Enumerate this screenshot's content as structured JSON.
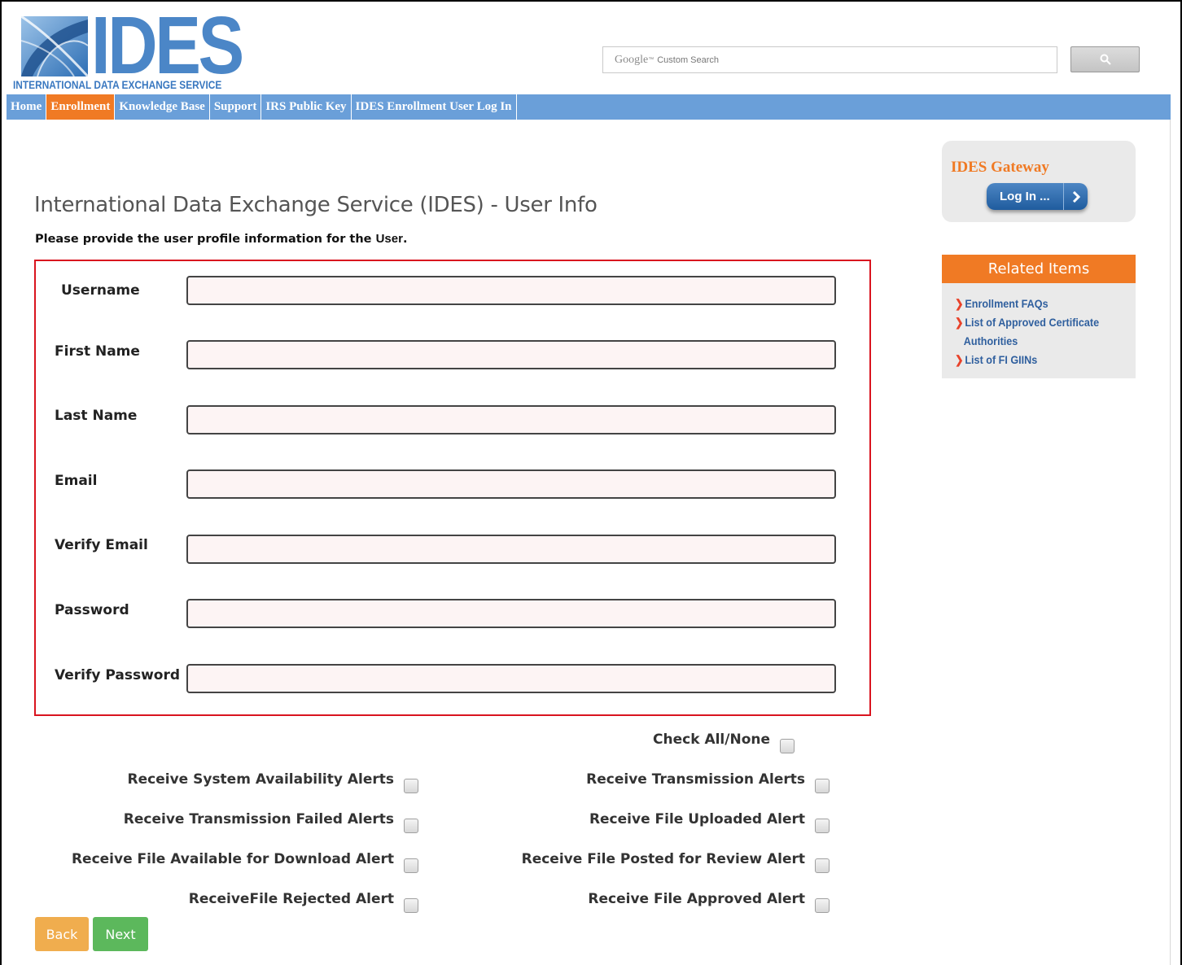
{
  "header": {
    "logo_text": "IDES",
    "logo_subtitle": "INTERNATIONAL DATA EXCHANGE SERVICE",
    "search": {
      "google_label": "Google",
      "tm": "™",
      "custom_search_label": "Custom Search",
      "button_icon": "search-icon"
    }
  },
  "nav": {
    "items": [
      {
        "label": "Home",
        "active": false
      },
      {
        "label": "Enrollment",
        "active": true
      },
      {
        "label": "Knowledge Base",
        "active": false
      },
      {
        "label": "Support",
        "active": false
      },
      {
        "label": "IRS Public Key",
        "active": false
      },
      {
        "label": "IDES Enrollment User Log In",
        "active": false
      }
    ]
  },
  "main": {
    "title": "International Data Exchange Service (IDES) - User Info",
    "instruction_prefix": "Please provide the user profile information for the ",
    "instruction_emphasis": "User",
    "instruction_suffix": ".",
    "fields": [
      {
        "label": "Username",
        "value": ""
      },
      {
        "label": "First Name",
        "value": ""
      },
      {
        "label": "Last Name",
        "value": ""
      },
      {
        "label": "Email",
        "value": ""
      },
      {
        "label": "Verify Email",
        "value": ""
      },
      {
        "label": "Password",
        "value": ""
      },
      {
        "label": "Verify Password",
        "value": ""
      }
    ],
    "check_all_label": "Check All/None",
    "alerts_left": [
      "Receive System Availability Alerts",
      "Receive Transmission Failed Alerts",
      "Receive File Available for Download Alert",
      "ReceiveFile Rejected Alert"
    ],
    "alerts_right": [
      "Receive Transmission Alerts",
      "Receive File Uploaded Alert",
      "Receive File Posted for Review Alert",
      "Receive File Approved Alert"
    ],
    "back_label": "Back",
    "next_label": "Next"
  },
  "sidebar": {
    "gateway_title": "IDES Gateway",
    "login_label": "Log In ...",
    "related_title": "Related Items",
    "related_links": [
      {
        "line1": "Enrollment FAQs"
      },
      {
        "line1": "List of Approved Certificate",
        "line2": "Authorities"
      },
      {
        "line1": "List of FI GIINs"
      }
    ]
  },
  "colors": {
    "nav_blue": "#6a9fd9",
    "accent_orange": "#f07a24",
    "form_border_red": "#d9141f",
    "back_button": "#f0ad4e",
    "next_button": "#5cb85c",
    "link_blue": "#2f5f9e"
  }
}
